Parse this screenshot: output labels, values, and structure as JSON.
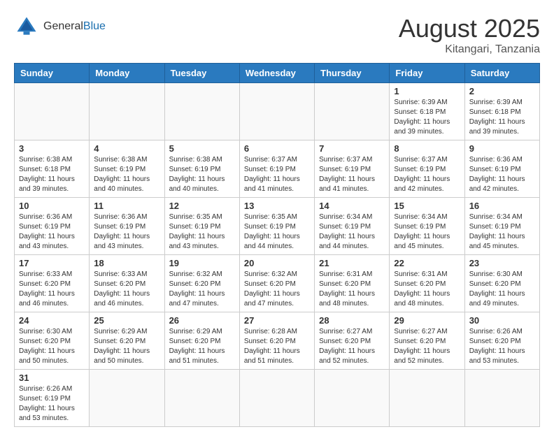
{
  "header": {
    "logo_general": "General",
    "logo_blue": "Blue",
    "month_title": "August 2025",
    "location": "Kitangari, Tanzania"
  },
  "days_of_week": [
    "Sunday",
    "Monday",
    "Tuesday",
    "Wednesday",
    "Thursday",
    "Friday",
    "Saturday"
  ],
  "weeks": [
    [
      {
        "day": "",
        "info": ""
      },
      {
        "day": "",
        "info": ""
      },
      {
        "day": "",
        "info": ""
      },
      {
        "day": "",
        "info": ""
      },
      {
        "day": "",
        "info": ""
      },
      {
        "day": "1",
        "info": "Sunrise: 6:39 AM\nSunset: 6:18 PM\nDaylight: 11 hours and 39 minutes."
      },
      {
        "day": "2",
        "info": "Sunrise: 6:39 AM\nSunset: 6:18 PM\nDaylight: 11 hours and 39 minutes."
      }
    ],
    [
      {
        "day": "3",
        "info": "Sunrise: 6:38 AM\nSunset: 6:18 PM\nDaylight: 11 hours and 39 minutes."
      },
      {
        "day": "4",
        "info": "Sunrise: 6:38 AM\nSunset: 6:19 PM\nDaylight: 11 hours and 40 minutes."
      },
      {
        "day": "5",
        "info": "Sunrise: 6:38 AM\nSunset: 6:19 PM\nDaylight: 11 hours and 40 minutes."
      },
      {
        "day": "6",
        "info": "Sunrise: 6:37 AM\nSunset: 6:19 PM\nDaylight: 11 hours and 41 minutes."
      },
      {
        "day": "7",
        "info": "Sunrise: 6:37 AM\nSunset: 6:19 PM\nDaylight: 11 hours and 41 minutes."
      },
      {
        "day": "8",
        "info": "Sunrise: 6:37 AM\nSunset: 6:19 PM\nDaylight: 11 hours and 42 minutes."
      },
      {
        "day": "9",
        "info": "Sunrise: 6:36 AM\nSunset: 6:19 PM\nDaylight: 11 hours and 42 minutes."
      }
    ],
    [
      {
        "day": "10",
        "info": "Sunrise: 6:36 AM\nSunset: 6:19 PM\nDaylight: 11 hours and 43 minutes."
      },
      {
        "day": "11",
        "info": "Sunrise: 6:36 AM\nSunset: 6:19 PM\nDaylight: 11 hours and 43 minutes."
      },
      {
        "day": "12",
        "info": "Sunrise: 6:35 AM\nSunset: 6:19 PM\nDaylight: 11 hours and 43 minutes."
      },
      {
        "day": "13",
        "info": "Sunrise: 6:35 AM\nSunset: 6:19 PM\nDaylight: 11 hours and 44 minutes."
      },
      {
        "day": "14",
        "info": "Sunrise: 6:34 AM\nSunset: 6:19 PM\nDaylight: 11 hours and 44 minutes."
      },
      {
        "day": "15",
        "info": "Sunrise: 6:34 AM\nSunset: 6:19 PM\nDaylight: 11 hours and 45 minutes."
      },
      {
        "day": "16",
        "info": "Sunrise: 6:34 AM\nSunset: 6:19 PM\nDaylight: 11 hours and 45 minutes."
      }
    ],
    [
      {
        "day": "17",
        "info": "Sunrise: 6:33 AM\nSunset: 6:20 PM\nDaylight: 11 hours and 46 minutes."
      },
      {
        "day": "18",
        "info": "Sunrise: 6:33 AM\nSunset: 6:20 PM\nDaylight: 11 hours and 46 minutes."
      },
      {
        "day": "19",
        "info": "Sunrise: 6:32 AM\nSunset: 6:20 PM\nDaylight: 11 hours and 47 minutes."
      },
      {
        "day": "20",
        "info": "Sunrise: 6:32 AM\nSunset: 6:20 PM\nDaylight: 11 hours and 47 minutes."
      },
      {
        "day": "21",
        "info": "Sunrise: 6:31 AM\nSunset: 6:20 PM\nDaylight: 11 hours and 48 minutes."
      },
      {
        "day": "22",
        "info": "Sunrise: 6:31 AM\nSunset: 6:20 PM\nDaylight: 11 hours and 48 minutes."
      },
      {
        "day": "23",
        "info": "Sunrise: 6:30 AM\nSunset: 6:20 PM\nDaylight: 11 hours and 49 minutes."
      }
    ],
    [
      {
        "day": "24",
        "info": "Sunrise: 6:30 AM\nSunset: 6:20 PM\nDaylight: 11 hours and 50 minutes."
      },
      {
        "day": "25",
        "info": "Sunrise: 6:29 AM\nSunset: 6:20 PM\nDaylight: 11 hours and 50 minutes."
      },
      {
        "day": "26",
        "info": "Sunrise: 6:29 AM\nSunset: 6:20 PM\nDaylight: 11 hours and 51 minutes."
      },
      {
        "day": "27",
        "info": "Sunrise: 6:28 AM\nSunset: 6:20 PM\nDaylight: 11 hours and 51 minutes."
      },
      {
        "day": "28",
        "info": "Sunrise: 6:27 AM\nSunset: 6:20 PM\nDaylight: 11 hours and 52 minutes."
      },
      {
        "day": "29",
        "info": "Sunrise: 6:27 AM\nSunset: 6:20 PM\nDaylight: 11 hours and 52 minutes."
      },
      {
        "day": "30",
        "info": "Sunrise: 6:26 AM\nSunset: 6:20 PM\nDaylight: 11 hours and 53 minutes."
      }
    ],
    [
      {
        "day": "31",
        "info": "Sunrise: 6:26 AM\nSunset: 6:19 PM\nDaylight: 11 hours and 53 minutes."
      },
      {
        "day": "",
        "info": ""
      },
      {
        "day": "",
        "info": ""
      },
      {
        "day": "",
        "info": ""
      },
      {
        "day": "",
        "info": ""
      },
      {
        "day": "",
        "info": ""
      },
      {
        "day": "",
        "info": ""
      }
    ]
  ]
}
